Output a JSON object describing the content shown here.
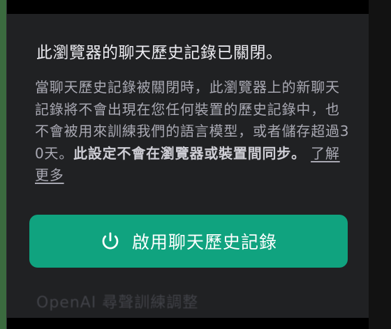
{
  "dialog": {
    "title": "此瀏覽器的聊天歷史記錄已關閉。",
    "body_text": "當聊天歷史記錄被關閉時，此瀏覽器上的新聊天記錄將不會出現在您任何裝置的歷史記錄中，也不會被用來訓練我們的語言模型，或者儲存超過30天。",
    "body_bold": "此設定不會在瀏覽器或裝置間同步。",
    "learn_more": "了解更多",
    "button_label": "啟用聊天歷史記錄",
    "button_icon": "power-icon",
    "faded_text": "OpenAI 尋聲訓練調整",
    "colors": {
      "panel": "#202123",
      "accent": "#10a37f",
      "title": "#ececf1",
      "body": "#a9a9b3"
    }
  }
}
